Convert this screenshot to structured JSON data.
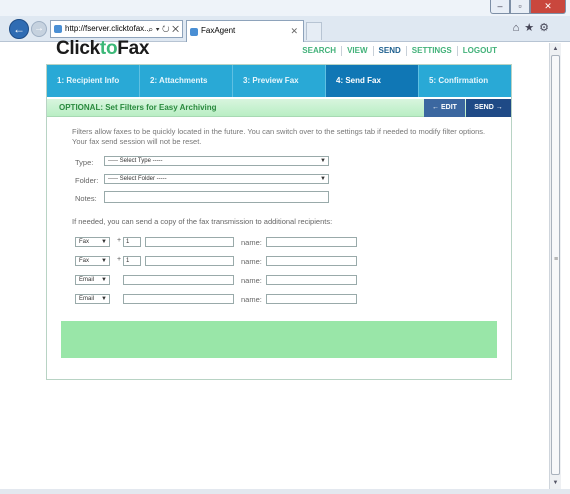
{
  "browser": {
    "address": "http://fserver.clicktofax...",
    "address_tools": "⌕ ▾ ↻ ✕",
    "tab_title": "FaxAgent",
    "tab_close": "✕",
    "win_min": "–",
    "win_max": "▫",
    "win_close": "✕",
    "back_glyph": "←",
    "forward_glyph": "→",
    "cmd_icons": "⌂★⚙",
    "grip": "≡"
  },
  "app": {
    "logo_prefix": "Click",
    "logo_to": "to",
    "logo_suffix": "Fax",
    "nav": [
      "SEARCH",
      "VIEW",
      "SEND",
      "SETTINGS",
      "LOGOUT"
    ],
    "active_nav": "SEND"
  },
  "steps": [
    "1: Recipient Info",
    "2: Attachments",
    "3: Preview Fax",
    "4: Send Fax",
    "5: Confirmation"
  ],
  "active_step": 3,
  "optbar": {
    "label": "OPTIONAL: Set Filters for Easy Archiving",
    "edit": "← EDIT",
    "send": "SEND →"
  },
  "form": {
    "intro": "Filters allow faxes to be quickly located in the future. You can switch over to the settings tab if needed to modify filter options. Your fax send session will not be reset.",
    "type_label": "Type:",
    "type_value": "----- Select Type -----",
    "folder_label": "Folder:",
    "folder_value": "----- Select Folder -----",
    "notes_label": "Notes:",
    "copy_label": "If needed, you can send a copy of the fax transmission to additional recipients:",
    "recipients": [
      {
        "method": "Fax",
        "prefix": "+",
        "code": "1",
        "name_label": "name:"
      },
      {
        "method": "Fax",
        "prefix": "+",
        "code": "1",
        "name_label": "name:"
      },
      {
        "method": "Email",
        "name_label": "name:"
      },
      {
        "method": "Email",
        "name_label": "name:"
      }
    ]
  }
}
